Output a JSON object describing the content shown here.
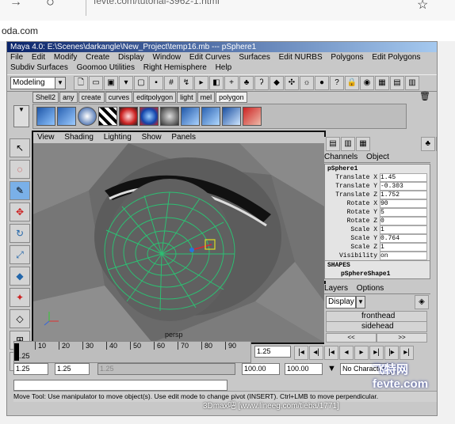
{
  "browser": {
    "url": "fevte.com/tutorial-3962-1.html",
    "tab_text": "oda.com"
  },
  "maya": {
    "title": "Maya 4.0: E:\\Scenes\\darkangle\\New_Project\\temp16.mb  ---  pSphere1",
    "menu_row1": [
      "File",
      "Edit",
      "Modify",
      "Create",
      "Display",
      "Window",
      "Edit Curves",
      "Surfaces",
      "Edit NURBS",
      "Polygons",
      "Edit Polygons"
    ],
    "menu_row2": [
      "Subdiv Surfaces",
      "Goomoo Utilities",
      "Right Hemisphere",
      "Help"
    ],
    "mode_select": "Modeling",
    "shelf_tabs": [
      "Shell2",
      "any",
      "create",
      "curves",
      "editpolygon",
      "light",
      "mel",
      "polygon"
    ],
    "viewport_menu": [
      "View",
      "Shading",
      "Lighting",
      "Show",
      "Panels"
    ],
    "viewport_label": "persp",
    "channels_header": [
      "Channels",
      "Object"
    ],
    "object_name": "pSphere1",
    "attributes": [
      {
        "label": "Translate X",
        "value": "1.45"
      },
      {
        "label": "Translate Y",
        "value": "-0.303"
      },
      {
        "label": "Translate Z",
        "value": "1.752"
      },
      {
        "label": "Rotate X",
        "value": "90"
      },
      {
        "label": "Rotate Y",
        "value": "5"
      },
      {
        "label": "Rotate Z",
        "value": "0"
      },
      {
        "label": "Scale X",
        "value": "1"
      },
      {
        "label": "Scale Y",
        "value": "0.764"
      },
      {
        "label": "Scale Z",
        "value": "1"
      },
      {
        "label": "Visibility",
        "value": "on"
      }
    ],
    "shapes_label": "SHAPES",
    "shape_name": "pSphereShape1",
    "layers_header": [
      "Layers",
      "Options"
    ],
    "layers_display": "Display",
    "layers": [
      "fronthead",
      "sidehead"
    ],
    "timeline_ticks": [
      "10",
      "20",
      "30",
      "40",
      "50",
      "60",
      "70",
      "80",
      "90"
    ],
    "timeline_current": "1.25",
    "current_time_field": "1.25",
    "range_start": "1.25",
    "range_inner_start": "1.25",
    "range_inner_end_dim": "1.25",
    "range_end": "100.00",
    "range_end2": "100.00",
    "character": "No Character",
    "help_line": "Move Tool: Use manipulator to move object(s). Use edit mode to change pivot (INSERT). Ctrl+LMB to move perpendicular."
  },
  "watermark": "3Dmax吧 [www.lineeg.com/tieba/1771]",
  "watermark_logo": "飞特网 fevte.com"
}
